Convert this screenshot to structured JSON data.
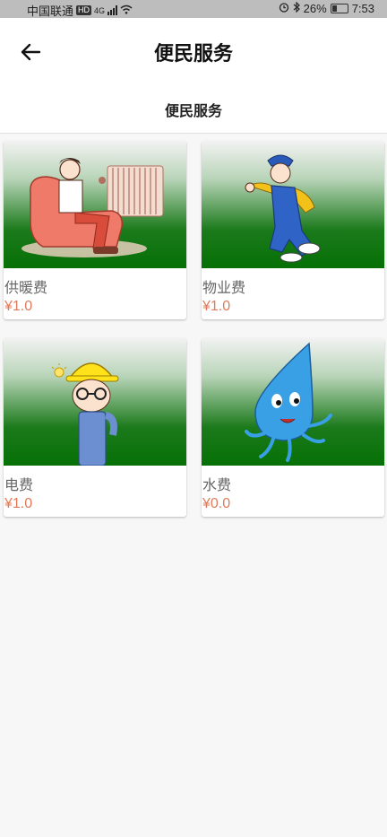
{
  "status_bar": {
    "carrier": "中国联通",
    "hd": "HD",
    "network": "4G",
    "battery": "26%",
    "time": "7:53"
  },
  "app_bar": {
    "title": "便民服务",
    "back_icon": "arrow-left-icon"
  },
  "tabs": [
    {
      "label": "便民服务"
    }
  ],
  "services": [
    {
      "name": "供暖费",
      "price": "¥1.0",
      "illustration": "man-on-sofa-with-radiator"
    },
    {
      "name": "物业费",
      "price": "¥1.0",
      "illustration": "handyman-in-overalls"
    },
    {
      "name": "电费",
      "price": "¥1.0",
      "illustration": "worker-with-hardhat"
    },
    {
      "name": "水费",
      "price": "¥0.0",
      "illustration": "water-drop-mascot"
    }
  ],
  "colors": {
    "price": "#e07a5a",
    "card_bg_top": "#f2f2f2",
    "card_bg_bottom": "#067006",
    "status_bar": "#bdbdbd"
  }
}
